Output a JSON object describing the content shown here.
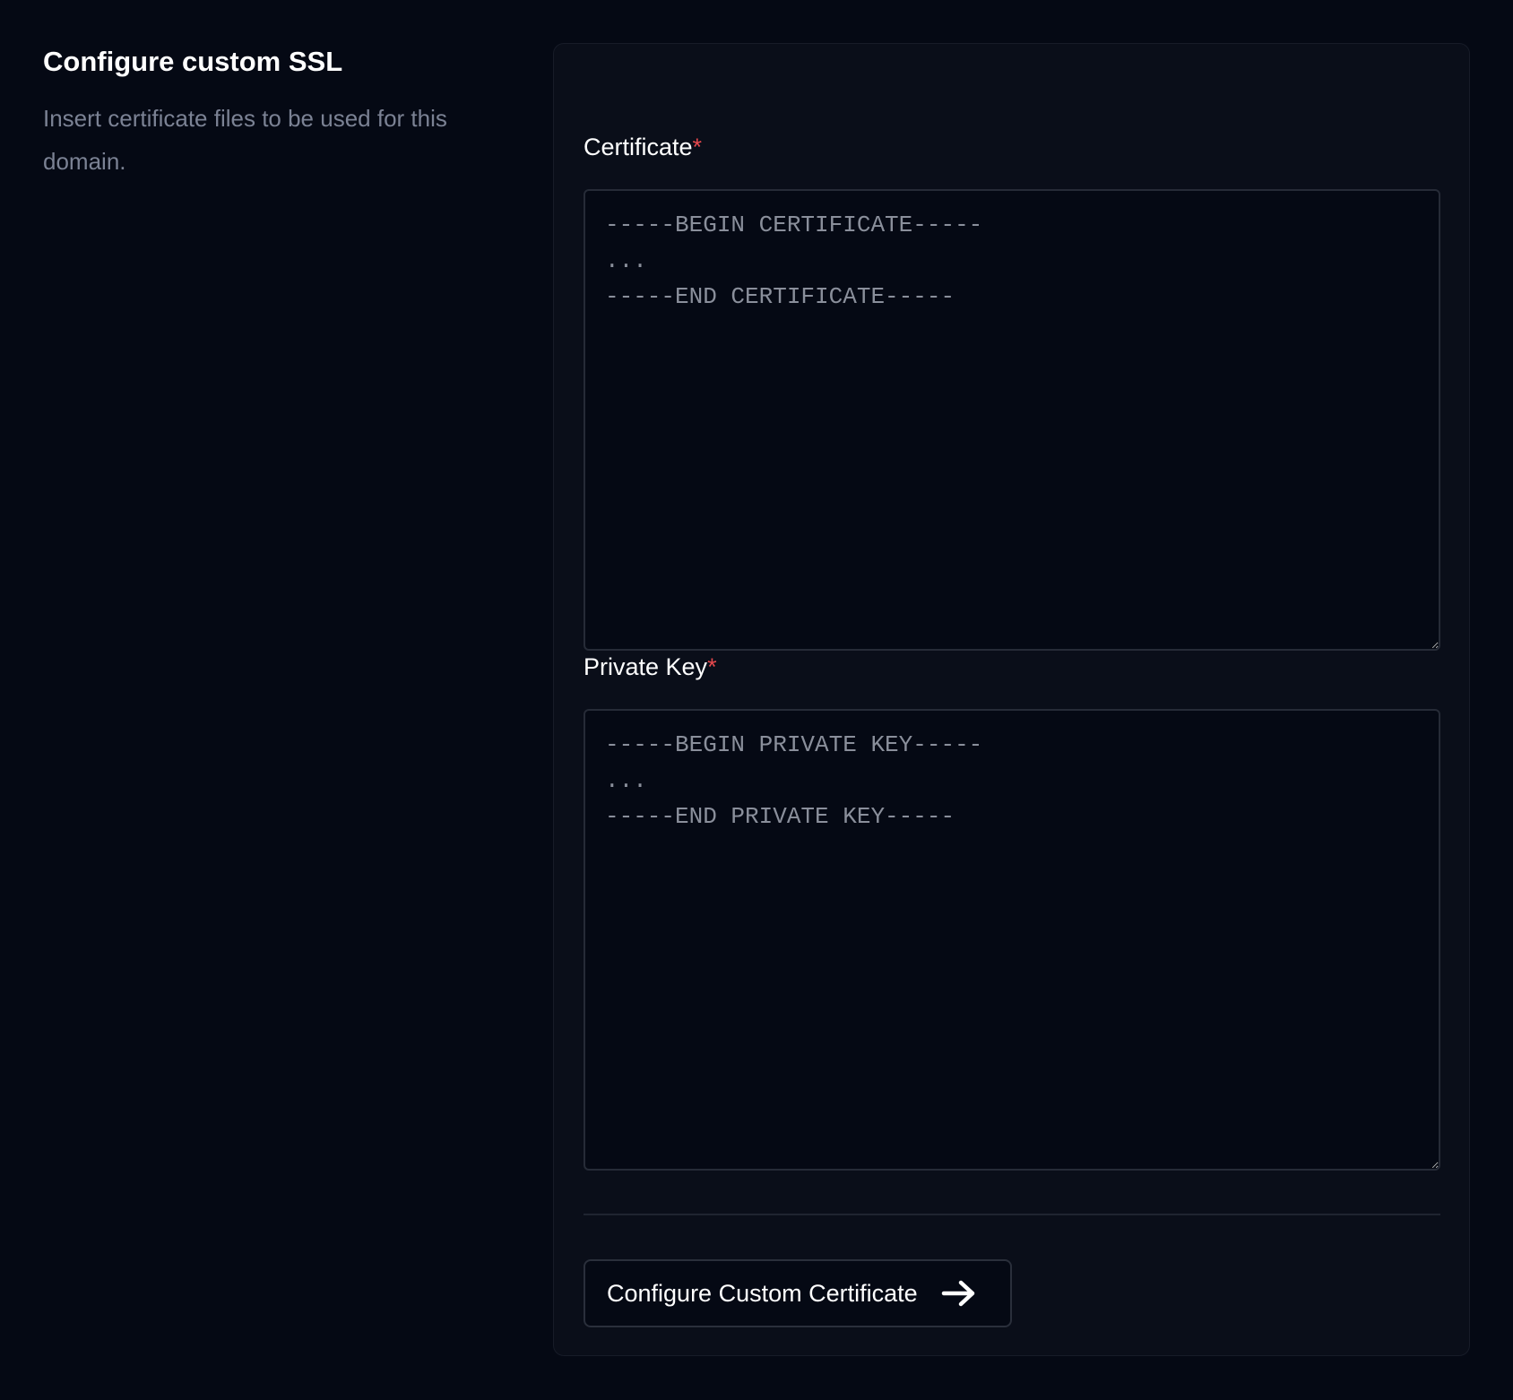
{
  "section": {
    "title": "Configure custom SSL",
    "description": "Insert certificate files to be used for this domain."
  },
  "form": {
    "certificate": {
      "label": "Certificate",
      "required_marker": "*",
      "value": "",
      "placeholder": "-----BEGIN CERTIFICATE-----\n...\n-----END CERTIFICATE-----"
    },
    "private_key": {
      "label": "Private Key",
      "required_marker": "*",
      "value": "",
      "placeholder": "-----BEGIN PRIVATE KEY-----\n...\n-----END PRIVATE KEY-----"
    },
    "submit_label": "Configure Custom Certificate",
    "submit_icon": "arrow-right-icon"
  },
  "colors": {
    "background": "#050914",
    "card": "#0a0e19",
    "required": "#e5484d",
    "muted_text": "#7b8294"
  }
}
